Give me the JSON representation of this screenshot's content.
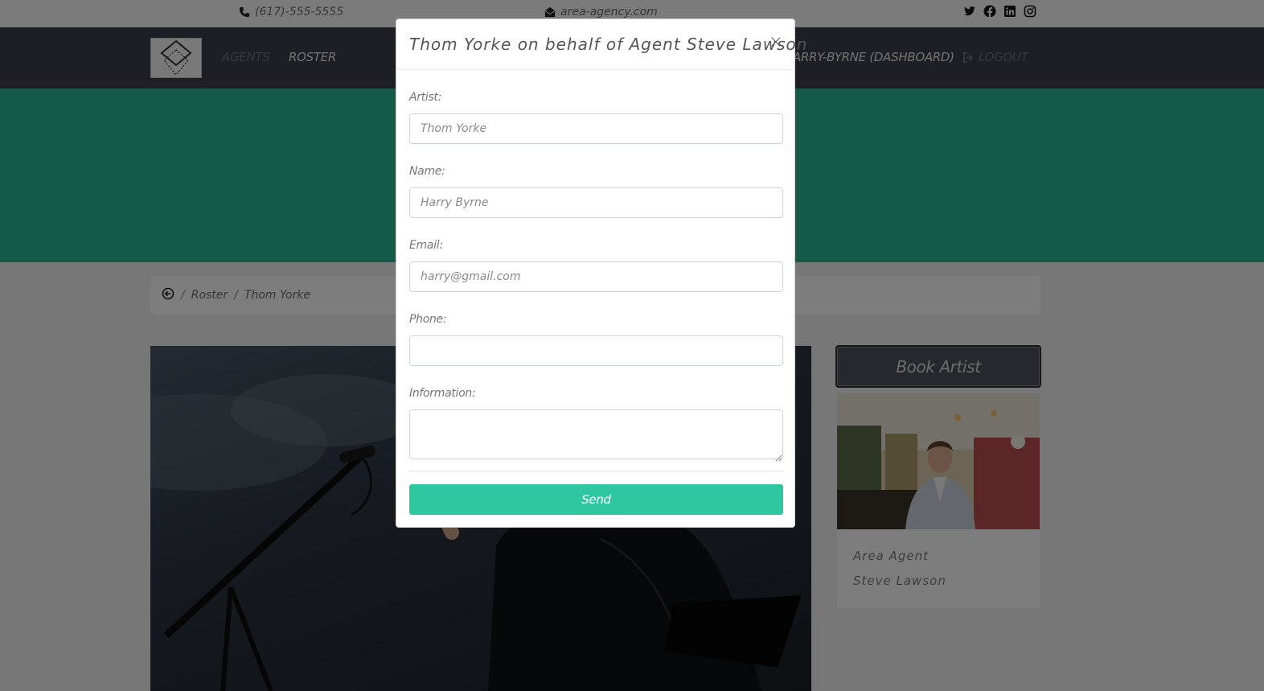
{
  "topbar": {
    "phone": "(617)-555-5555",
    "email": "area-agency.com",
    "social_icons": [
      "twitter-icon",
      "facebook-icon",
      "linkedin-icon",
      "instagram-icon"
    ]
  },
  "nav": {
    "agents_label": "AGENTS",
    "roster_label": "ROSTER",
    "dashboard_label": "HARRY-BYRNE (DASHBOARD)",
    "logout_label": "LOGOUT"
  },
  "breadcrumb": {
    "back_icon": "circle-arrow-left-icon",
    "roster_label": "Roster",
    "artist_label": "Thom Yorke",
    "separator": "/"
  },
  "sidebar": {
    "book_label": "Book Artist",
    "agent_title": "Area Agent",
    "agent_name": "Steve Lawson"
  },
  "modal": {
    "title": "Thom Yorke on behalf of Agent Steve Lawson",
    "close_label": "×",
    "artist_label": "Artist:",
    "artist_placeholder": "Thom Yorke",
    "name_label": "Name:",
    "name_placeholder": "Harry Byrne",
    "email_label": "Email:",
    "email_placeholder": "harry@gmail.com",
    "phone_label": "Phone:",
    "phone_value": "",
    "info_label": "Information:",
    "info_value": "",
    "send_label": "Send"
  },
  "colors": {
    "nav_bg": "#3d3f48",
    "hero_accent": "#2bb493",
    "send_button": "#2fc79f"
  }
}
